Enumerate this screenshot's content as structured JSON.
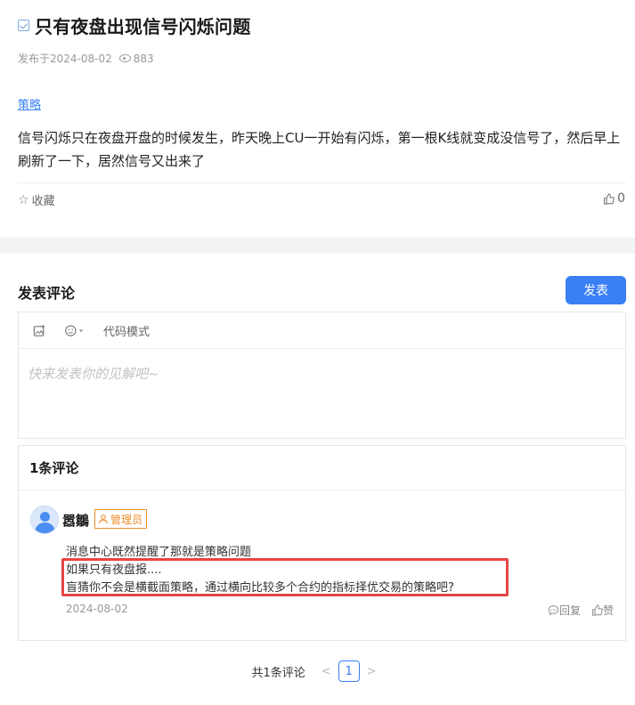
{
  "post": {
    "title": "只有夜盘出现信号闪烁问题",
    "published": "发布于2024-08-02",
    "views": "883",
    "tag": "策略",
    "body": "信号闪烁只在夜盘开盘的时候发生，昨天晚上CU一开始有闪烁，第一根K线就变成没信号了，然后早上刷新了一下，居然信号又出来了",
    "favorite_label": "收藏",
    "like_count": "0"
  },
  "comment_editor": {
    "section_title": "发表评论",
    "publish_label": "发表",
    "code_mode_label": "代码模式",
    "placeholder": "快来发表你的见解吧~"
  },
  "comments": {
    "count_label": "1条评论",
    "items": [
      {
        "username": "嚣鶵",
        "badge": "管理员",
        "lines": [
          "消息中心既然提醒了那就是策略问题",
          "如果只有夜盘报....",
          "盲猜你不会是横截面策略，通过横向比较多个合约的指标择优交易的策略吧?"
        ],
        "date": "2024-08-02",
        "reply_label": "回复",
        "like_label": "赞"
      }
    ]
  },
  "pagination": {
    "total_label": "共1条评论",
    "current_page": "1"
  },
  "colors": {
    "accent": "#3b7ff5",
    "badge": "#f08c2e",
    "highlight": "#e64545"
  }
}
